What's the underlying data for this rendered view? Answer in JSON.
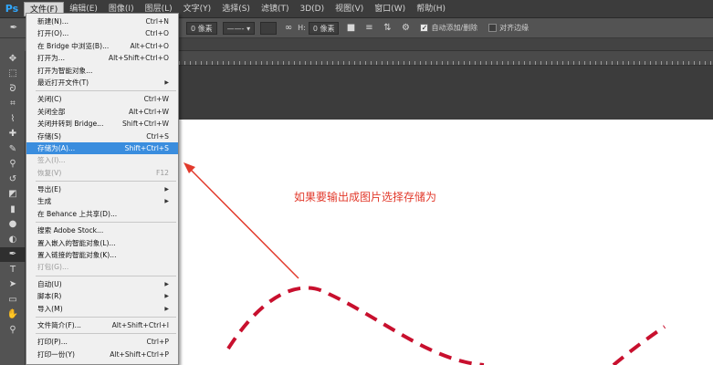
{
  "app": {
    "logo": "Ps"
  },
  "menubar": {
    "items": [
      {
        "label": "文件(F)",
        "active": true
      },
      {
        "label": "编辑(E)"
      },
      {
        "label": "图像(I)"
      },
      {
        "label": "图层(L)"
      },
      {
        "label": "文字(Y)"
      },
      {
        "label": "选择(S)"
      },
      {
        "label": "滤镜(T)"
      },
      {
        "label": "3D(D)"
      },
      {
        "label": "视图(V)"
      },
      {
        "label": "窗口(W)"
      },
      {
        "label": "帮助(H)"
      }
    ]
  },
  "options": {
    "width_value": "0 像素",
    "height_label": "H:",
    "height_value": "0 像素",
    "auto_add_delete": "自动添加/删除",
    "align_edges": "对齐边缘"
  },
  "file_menu": {
    "items": [
      {
        "label": "新建(N)...",
        "shortcut": "Ctrl+N"
      },
      {
        "label": "打开(O)...",
        "shortcut": "Ctrl+O"
      },
      {
        "label": "在 Bridge 中浏览(B)...",
        "shortcut": "Alt+Ctrl+O"
      },
      {
        "label": "打开为...",
        "shortcut": "Alt+Shift+Ctrl+O"
      },
      {
        "label": "打开为智能对象..."
      },
      {
        "label": "最近打开文件(T)",
        "submenu": true
      },
      {
        "sep": true
      },
      {
        "label": "关闭(C)",
        "shortcut": "Ctrl+W"
      },
      {
        "label": "关闭全部",
        "shortcut": "Alt+Ctrl+W"
      },
      {
        "label": "关闭并转到 Bridge...",
        "shortcut": "Shift+Ctrl+W"
      },
      {
        "label": "存储(S)",
        "shortcut": "Ctrl+S"
      },
      {
        "label": "存储为(A)...",
        "shortcut": "Shift+Ctrl+S",
        "highlight": true
      },
      {
        "label": "签入(I)...",
        "disabled": true
      },
      {
        "label": "恢复(V)",
        "shortcut": "F12",
        "disabled": true
      },
      {
        "sep": true
      },
      {
        "label": "导出(E)",
        "submenu": true
      },
      {
        "label": "生成",
        "submenu": true
      },
      {
        "label": "在 Behance 上共享(D)..."
      },
      {
        "sep": true
      },
      {
        "label": "搜索 Adobe Stock..."
      },
      {
        "label": "置入嵌入的智能对象(L)..."
      },
      {
        "label": "置入链接的智能对象(K)..."
      },
      {
        "label": "打包(G)...",
        "disabled": true
      },
      {
        "sep": true
      },
      {
        "label": "自动(U)",
        "submenu": true
      },
      {
        "label": "脚本(R)",
        "submenu": true
      },
      {
        "label": "导入(M)",
        "submenu": true
      },
      {
        "sep": true
      },
      {
        "label": "文件简介(F)...",
        "shortcut": "Alt+Shift+Ctrl+I"
      },
      {
        "sep": true
      },
      {
        "label": "打印(P)...",
        "shortcut": "Ctrl+P"
      },
      {
        "label": "打印一份(Y)",
        "shortcut": "Alt+Shift+Ctrl+P"
      }
    ]
  },
  "annotation": {
    "text": "如果要输出成图片选择存储为"
  },
  "colors": {
    "accent": "#3a8dde",
    "annotation": "#e23a2c",
    "curve": "#c8102e"
  },
  "tools": [
    "move-icon",
    "marquee-icon",
    "lasso-icon",
    "crop-icon",
    "eyedropper-icon",
    "healing-icon",
    "brush-icon",
    "stamp-icon",
    "history-brush-icon",
    "eraser-icon",
    "gradient-icon",
    "blur-icon",
    "dodge-icon",
    "pen-icon",
    "type-icon",
    "path-select-icon",
    "shape-icon",
    "hand-icon",
    "zoom-icon"
  ]
}
